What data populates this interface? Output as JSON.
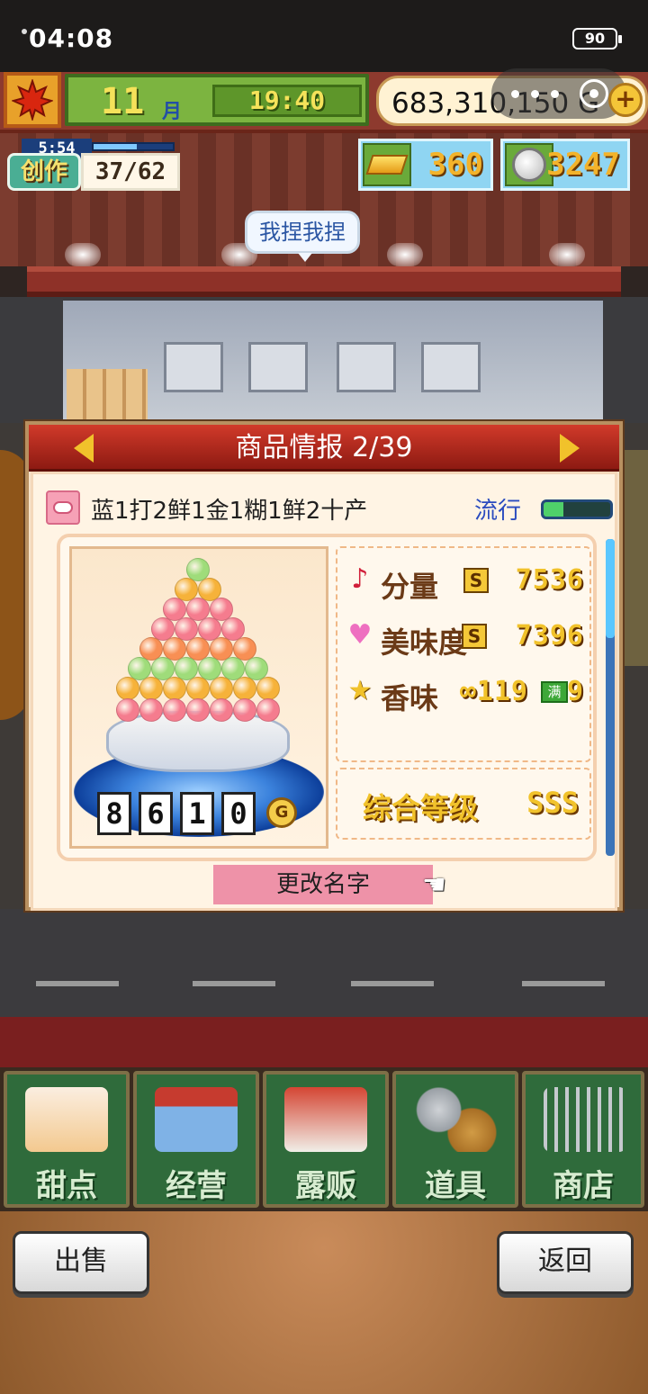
{
  "status_bar": {
    "time": "04:08",
    "battery": "90"
  },
  "hud": {
    "month": "11",
    "month_unit": "月",
    "clock": "19:40",
    "money": "683,310,150",
    "money_unit": "G",
    "gold_bars": "360",
    "silver_coins": "3247",
    "create_label": "创作",
    "create_timer": "5:54",
    "create_progress": "37/62",
    "create_timer_fill": 0.55
  },
  "speech_bubble": "我捏我捏",
  "dialog": {
    "title": "商品情报 2/39",
    "product_name": "蓝1打2鲜1金1糊1鲜2十产",
    "trend_label": "流行",
    "trend_level": 0.3,
    "price_digits": [
      "8",
      "6",
      "1",
      "0"
    ],
    "price_unit": "G",
    "stats": [
      {
        "icon": "music-note-icon",
        "name": "分量",
        "rank": "S",
        "value": "7536"
      },
      {
        "icon": "heart-icon",
        "name": "美味度",
        "rank": "S",
        "value": "7396"
      },
      {
        "icon": "star-icon",
        "name": "香味",
        "rank": "",
        "value": "∞119",
        "tail": "9",
        "max_tag": "满"
      }
    ],
    "overall_label": "综合等级",
    "overall_rank": "SSS",
    "rename_label": "更改名字"
  },
  "menu": [
    {
      "label": "甜点",
      "icon": "cake-icon"
    },
    {
      "label": "经营",
      "icon": "shop-icon"
    },
    {
      "label": "露贩",
      "icon": "food-truck-icon"
    },
    {
      "label": "道具",
      "icon": "items-bag-icon"
    },
    {
      "label": "商店",
      "icon": "shopping-cart-icon"
    }
  ],
  "buttons": {
    "sell": "出售",
    "back": "返回"
  },
  "colors": {
    "accent_red": "#c0281c",
    "gold": "#f1c22b",
    "menu_green": "#2f6b3b",
    "rank_gold": "#f4c838"
  }
}
